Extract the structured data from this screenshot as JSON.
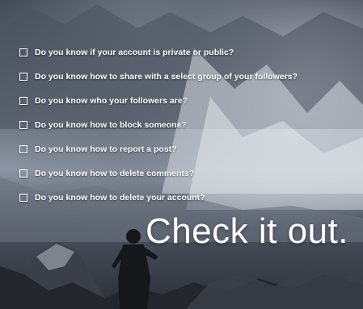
{
  "checklist": [
    "Do you know if your account is private or public?",
    "Do you know how to share with a select group of your followers?",
    "Do you know who your followers are?",
    "Do you know how to block someone?",
    "Do you know how to report a post?",
    "Do you know how to delete comments?",
    "Do you know how to delete your account?"
  ],
  "cta": "Check it out.",
  "colors": {
    "text": "#ffffff",
    "sky": "#8c95a3",
    "rock": "#2a2e35"
  }
}
